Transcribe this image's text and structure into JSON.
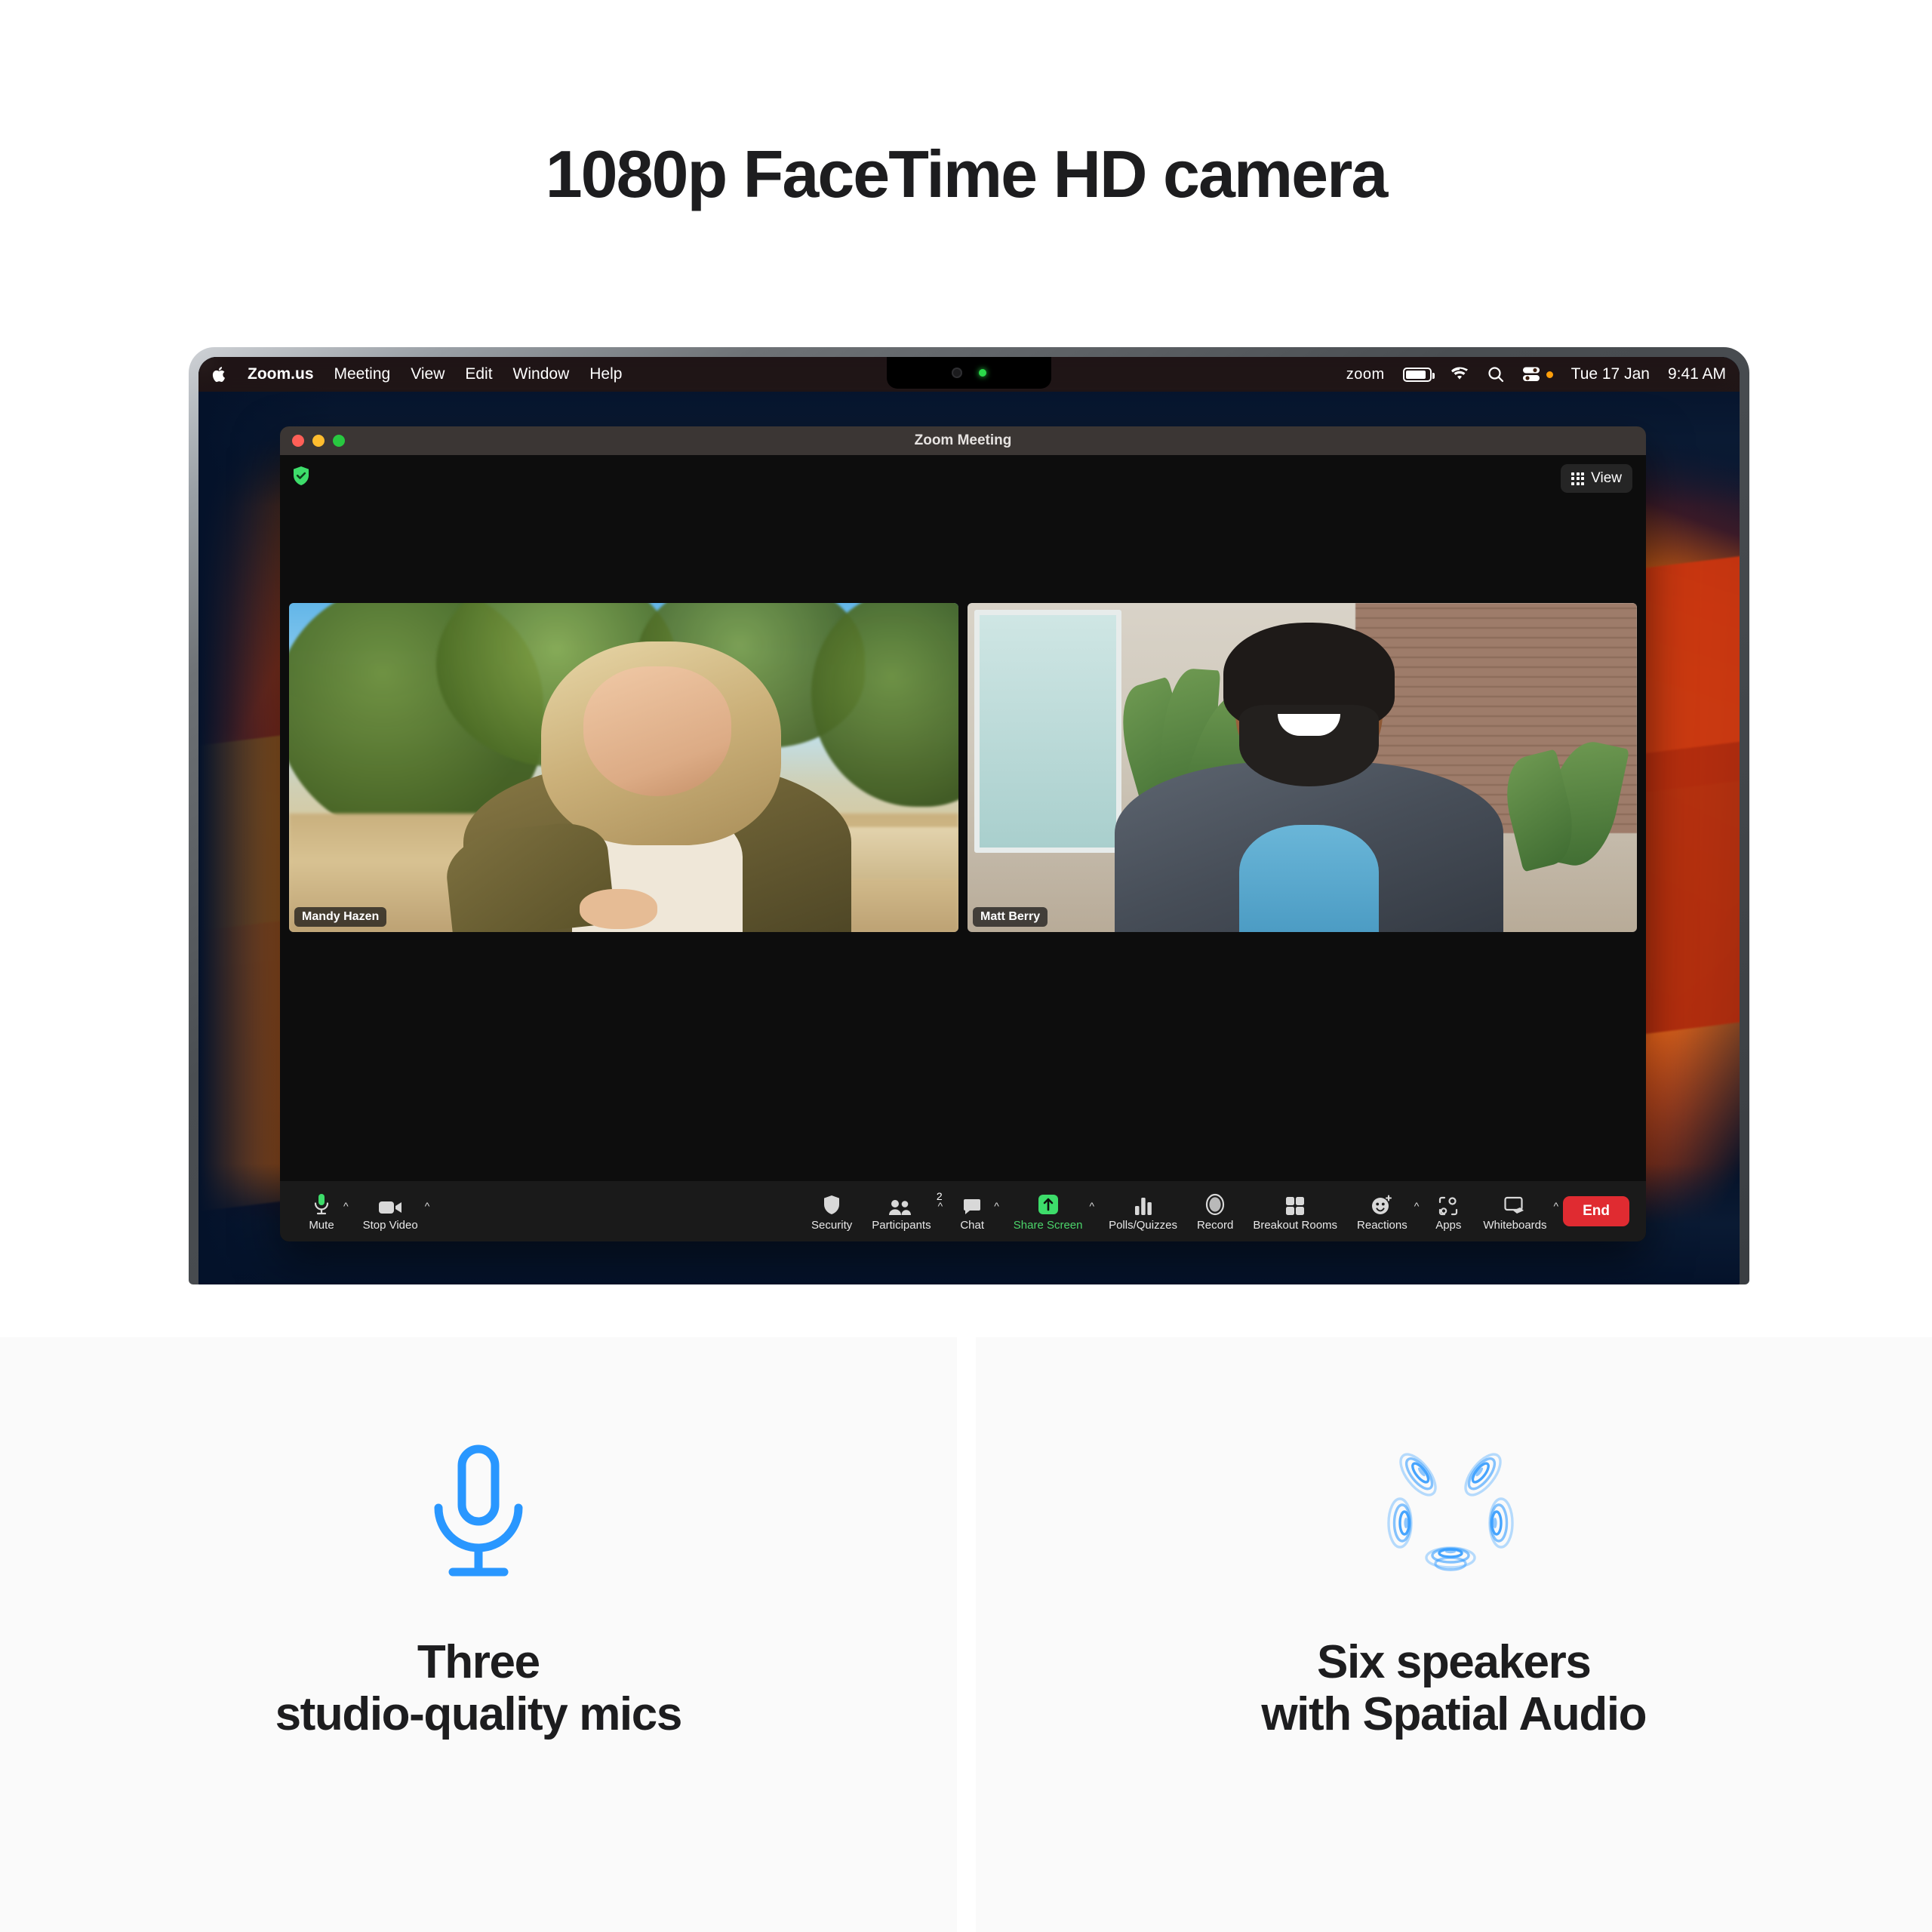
{
  "hero": {
    "title": "1080p FaceTime HD camera"
  },
  "laptop": {
    "notch": {
      "camera_icon": "camera-lens-icon",
      "led_icon": "camera-indicator-led"
    }
  },
  "menubar": {
    "apple_icon": "apple-logo-icon",
    "left_items": [
      {
        "label": "Zoom.us",
        "bold": true
      },
      {
        "label": "Meeting",
        "bold": false
      },
      {
        "label": "View",
        "bold": false
      },
      {
        "label": "Edit",
        "bold": false
      },
      {
        "label": "Window",
        "bold": false
      },
      {
        "label": "Help",
        "bold": false
      }
    ],
    "right": {
      "zoom_label": "zoom",
      "battery_icon": "battery-icon",
      "wifi_icon": "wifi-icon",
      "search_icon": "search-icon",
      "control_center_icon": "control-center-icon",
      "date": "Tue 17 Jan",
      "time": "9:41 AM"
    }
  },
  "zoom_window": {
    "title": "Zoom Meeting",
    "traffic_lights": [
      "close",
      "minimize",
      "maximize"
    ],
    "encryption_badge_icon": "shield-check-icon",
    "view_button": {
      "label": "View",
      "icon": "grid-icon"
    },
    "participants": [
      {
        "name": "Mandy Hazen"
      },
      {
        "name": "Matt Berry"
      }
    ],
    "toolbar": {
      "items": [
        {
          "label": "Mute",
          "icon": "microphone-icon",
          "caret": true,
          "active": false
        },
        {
          "label": "Stop Video",
          "icon": "video-camera-icon",
          "caret": true,
          "active": false
        },
        {
          "label": "Security",
          "icon": "shield-icon",
          "caret": false,
          "active": false
        },
        {
          "label": "Participants",
          "icon": "people-icon",
          "caret": true,
          "active": false,
          "badge": "2"
        },
        {
          "label": "Chat",
          "icon": "chat-bubble-icon",
          "caret": true,
          "active": false
        },
        {
          "label": "Share Screen",
          "icon": "share-screen-icon",
          "caret": true,
          "active": true
        },
        {
          "label": "Polls/Quizzes",
          "icon": "bar-chart-icon",
          "caret": false,
          "active": false
        },
        {
          "label": "Record",
          "icon": "record-circle-icon",
          "caret": false,
          "active": false
        },
        {
          "label": "Breakout Rooms",
          "icon": "grid-squares-icon",
          "caret": false,
          "active": false
        },
        {
          "label": "Reactions",
          "icon": "smiley-plus-icon",
          "caret": true,
          "active": false
        },
        {
          "label": "Apps",
          "icon": "apps-icon",
          "caret": false,
          "active": false
        },
        {
          "label": "Whiteboards",
          "icon": "whiteboard-icon",
          "caret": true,
          "active": false
        }
      ],
      "end_button": "End",
      "accent_green": "#4bd46a",
      "end_color": "#e02b31"
    }
  },
  "features": [
    {
      "icon": "microphone-icon",
      "line1": "Three",
      "line2": "studio-quality mics",
      "icon_color": "#2997ff"
    },
    {
      "icon": "six-speakers-spatial-audio-icon",
      "line1": "Six speakers",
      "line2": "with Spatial Audio",
      "icon_color": "#2997ff"
    }
  ]
}
